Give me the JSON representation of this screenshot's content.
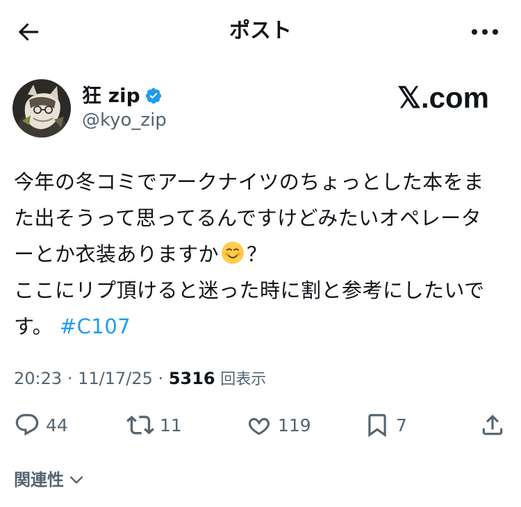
{
  "header": {
    "title": "ポスト",
    "back_icon": "arrow-left-icon",
    "more_icon": "more-horizontal-icon"
  },
  "author": {
    "display_name": "狂 zip",
    "handle": "@kyo_zip",
    "verified_color": "#1d9bf0"
  },
  "watermark": "𝕏.com",
  "post": {
    "lines": [
      "今年の冬コミでアークナイツのちょっとした本をま",
      "た出そうって思ってるんですけどみたいオペレータ",
      "ーとか衣装ありますか",
      "？",
      "ここにリプ頂けると迷った時に割と参考にしたいで",
      "す。"
    ],
    "hashtag": "#C107",
    "emoji": "smiling-face-icon"
  },
  "meta": {
    "time": "20:23",
    "date": "11/17/25",
    "separator": "·",
    "views_count": "5316",
    "views_label": "回表示"
  },
  "actions": {
    "replies": "44",
    "reposts": "11",
    "likes": "119",
    "bookmarks": "7"
  },
  "related": {
    "label": "関連性"
  },
  "colors": {
    "text": "#0f1419",
    "secondary": "#536471",
    "accent": "#1d9bf0"
  }
}
